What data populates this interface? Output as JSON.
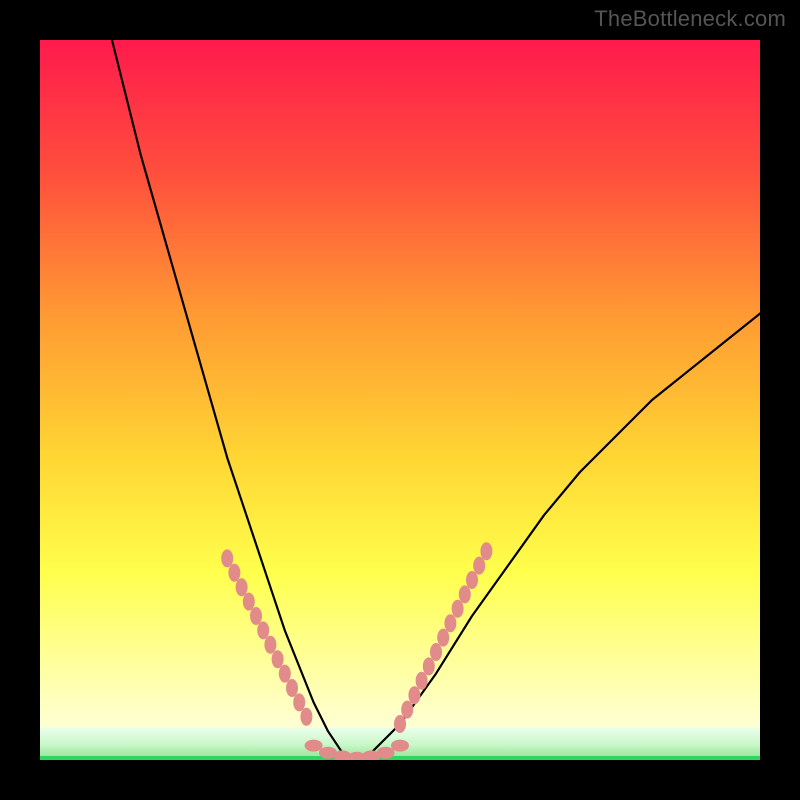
{
  "watermark": "TheBottleneck.com",
  "chart_data": {
    "type": "line",
    "title": "",
    "xlabel": "",
    "ylabel": "",
    "xlim": [
      0,
      100
    ],
    "ylim": [
      0,
      100
    ],
    "grid": false,
    "background_gradient": {
      "top": "#ff1a4d",
      "upper_mid": "#ff7a33",
      "mid": "#ffd633",
      "lower_mid": "#ffff66",
      "lower": "#ffff99",
      "bottom_band": "#d9ffb3",
      "bottom_line": "#2fd65f"
    },
    "series": [
      {
        "name": "bottleneck-curve",
        "x": [
          10,
          12,
          14,
          16,
          18,
          20,
          22,
          24,
          26,
          28,
          30,
          32,
          34,
          36,
          38,
          40,
          42,
          44,
          46,
          50,
          55,
          60,
          65,
          70,
          75,
          80,
          85,
          90,
          95,
          100
        ],
        "y": [
          100,
          92,
          84,
          77,
          70,
          63,
          56,
          49,
          42,
          36,
          30,
          24,
          18,
          13,
          8,
          4,
          1,
          0,
          1,
          5,
          12,
          20,
          27,
          34,
          40,
          45,
          50,
          54,
          58,
          62
        ],
        "note": "Y values estimated from pixel heights; minimum (optimal) near x≈44."
      },
      {
        "name": "highlight-dots-left",
        "x": [
          26,
          27,
          28,
          29,
          30,
          31,
          32,
          33,
          34,
          35,
          36,
          37
        ],
        "y": [
          28,
          26,
          24,
          22,
          20,
          18,
          16,
          14,
          12,
          10,
          8,
          6
        ]
      },
      {
        "name": "highlight-dots-bottom",
        "x": [
          38,
          40,
          42,
          44,
          46,
          48,
          50
        ],
        "y": [
          2,
          1,
          0.5,
          0.3,
          0.5,
          1,
          2
        ]
      },
      {
        "name": "highlight-dots-right",
        "x": [
          50,
          51,
          52,
          53,
          54,
          55,
          56,
          57,
          58,
          59,
          60,
          61,
          62
        ],
        "y": [
          5,
          7,
          9,
          11,
          13,
          15,
          17,
          19,
          21,
          23,
          25,
          27,
          29
        ]
      }
    ],
    "annotations": []
  }
}
